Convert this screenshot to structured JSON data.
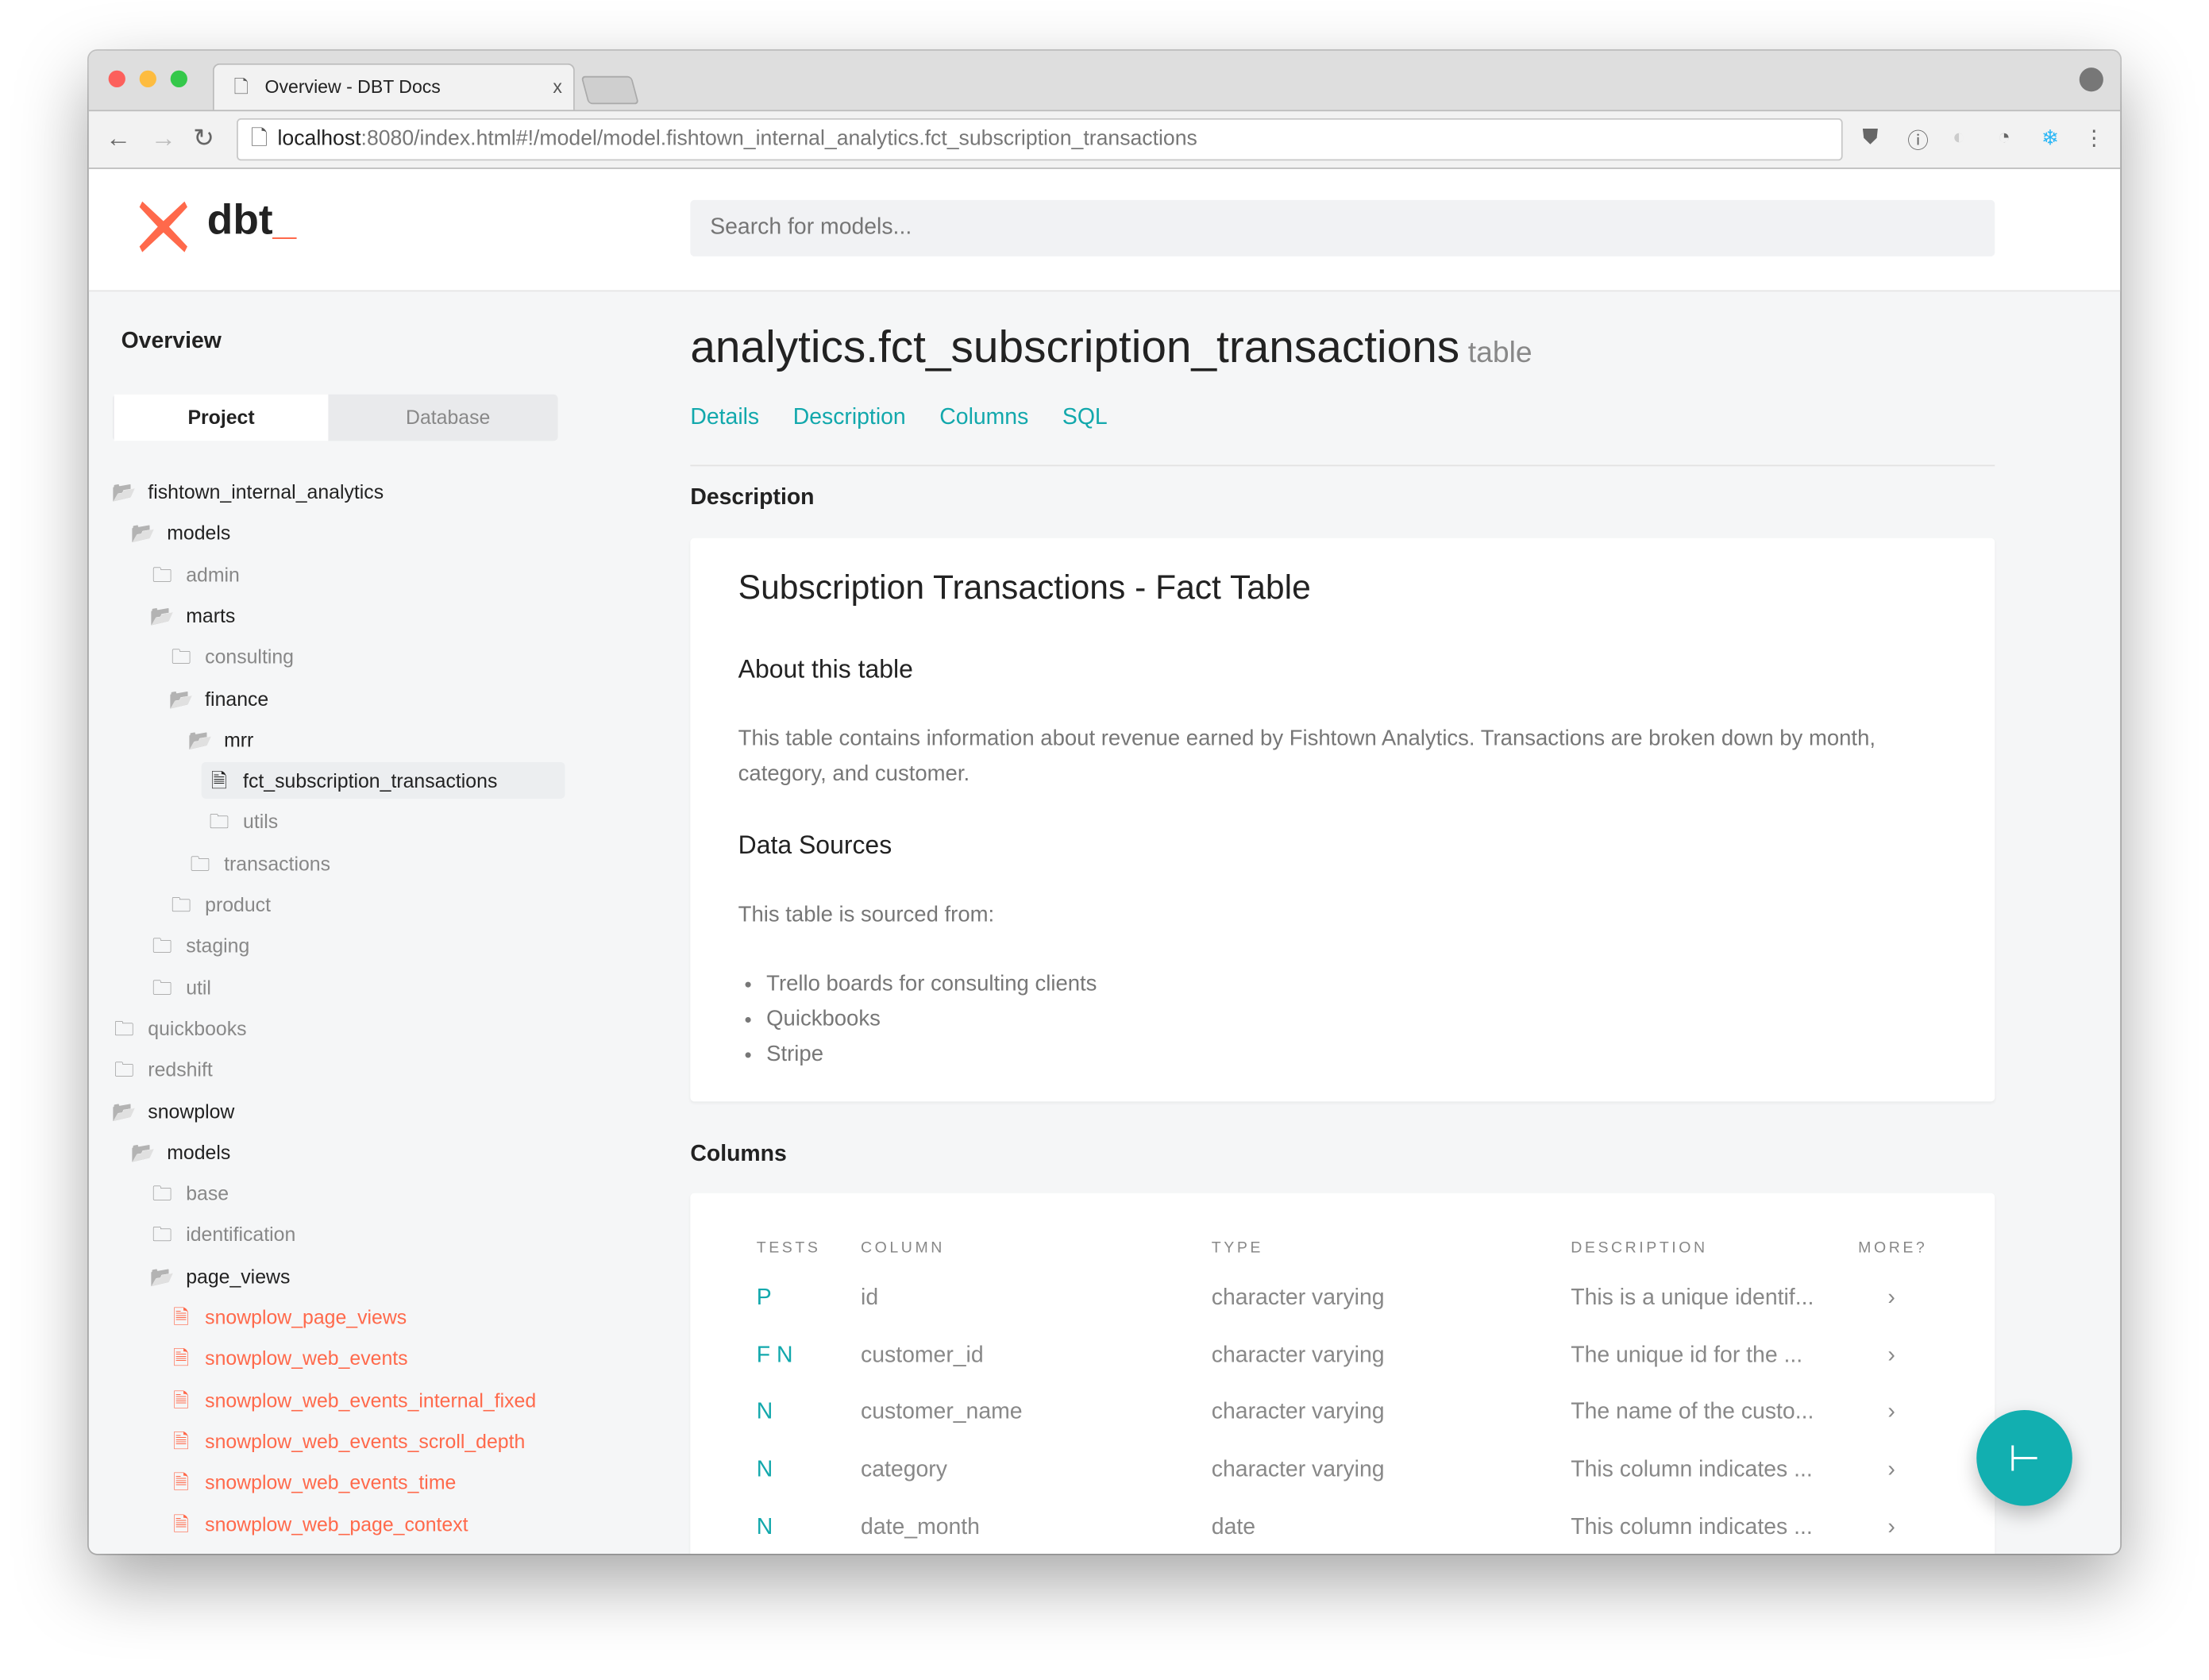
{
  "browser": {
    "tab_title": "Overview - DBT Docs",
    "tab_close": "x",
    "url_host": "localhost",
    "url_rest": ":8080/index.html#!/model/model.fishtown_internal_analytics.fct_subscription_transactions"
  },
  "header": {
    "logo_text": "dbt",
    "logo_underscore": "_",
    "search_placeholder": "Search for models..."
  },
  "sidebar": {
    "title": "Overview",
    "toggle": [
      "Project",
      "Database"
    ],
    "tree": [
      {
        "label": "fishtown_internal_analytics",
        "depth": 0,
        "kind": "folder-open"
      },
      {
        "label": "models",
        "depth": 1,
        "kind": "folder-open"
      },
      {
        "label": "admin",
        "depth": 2,
        "kind": "folder"
      },
      {
        "label": "marts",
        "depth": 2,
        "kind": "folder-open"
      },
      {
        "label": "consulting",
        "depth": 3,
        "kind": "folder"
      },
      {
        "label": "finance",
        "depth": 3,
        "kind": "folder-open"
      },
      {
        "label": "mrr",
        "depth": 4,
        "kind": "folder-open"
      },
      {
        "label": "fct_subscription_transactions",
        "depth": 5,
        "kind": "file-selected"
      },
      {
        "label": "utils",
        "depth": 5,
        "kind": "folder"
      },
      {
        "label": "transactions",
        "depth": 4,
        "kind": "folder"
      },
      {
        "label": "product",
        "depth": 3,
        "kind": "folder"
      },
      {
        "label": "staging",
        "depth": 2,
        "kind": "folder"
      },
      {
        "label": "util",
        "depth": 2,
        "kind": "folder"
      },
      {
        "label": "quickbooks",
        "depth": 0,
        "kind": "folder"
      },
      {
        "label": "redshift",
        "depth": 0,
        "kind": "folder"
      },
      {
        "label": "snowplow",
        "depth": 0,
        "kind": "folder-open"
      },
      {
        "label": "models",
        "depth": 1,
        "kind": "folder-open"
      },
      {
        "label": "base",
        "depth": 2,
        "kind": "folder"
      },
      {
        "label": "identification",
        "depth": 2,
        "kind": "folder"
      },
      {
        "label": "page_views",
        "depth": 2,
        "kind": "folder-open"
      },
      {
        "label": "snowplow_page_views",
        "depth": 3,
        "kind": "file-red"
      },
      {
        "label": "snowplow_web_events",
        "depth": 3,
        "kind": "file-red"
      },
      {
        "label": "snowplow_web_events_internal_fixed",
        "depth": 3,
        "kind": "file-red"
      },
      {
        "label": "snowplow_web_events_scroll_depth",
        "depth": 3,
        "kind": "file-red"
      },
      {
        "label": "snowplow_web_events_time",
        "depth": 3,
        "kind": "file-red"
      },
      {
        "label": "snowplow_web_page_context",
        "depth": 3,
        "kind": "file-red"
      }
    ]
  },
  "main": {
    "title": "analytics.fct_subscription_transactions",
    "title_type": "table",
    "tabs": [
      "Details",
      "Description",
      "Columns",
      "SQL"
    ],
    "description_heading": "Description",
    "doc": {
      "h1": "Subscription Transactions - Fact Table",
      "about_heading": "About this table",
      "about_text": "This table contains information about revenue earned by Fishtown Analytics. Transactions are broken down by month, category, and customer.",
      "sources_heading": "Data Sources",
      "sources_text": "This table is sourced from:",
      "sources": [
        "Trello boards for consulting clients",
        "Quickbooks",
        "Stripe"
      ]
    },
    "columns_heading": "Columns",
    "columns_table": {
      "headers": [
        "TESTS",
        "COLUMN",
        "TYPE",
        "DESCRIPTION",
        "MORE?"
      ],
      "rows": [
        {
          "tests": "P",
          "column": "id",
          "type": "character varying",
          "description": "This is a unique identif...",
          "more": "›"
        },
        {
          "tests": "F N",
          "column": "customer_id",
          "type": "character varying",
          "description": "The unique id for the ...",
          "more": "›"
        },
        {
          "tests": "N",
          "column": "customer_name",
          "type": "character varying",
          "description": "The name of the custo...",
          "more": "›"
        },
        {
          "tests": "N",
          "column": "category",
          "type": "character varying",
          "description": "This column indicates ...",
          "more": "›"
        },
        {
          "tests": "N",
          "column": "date_month",
          "type": "date",
          "description": "This column indicates ...",
          "more": "›"
        }
      ]
    }
  },
  "colors": {
    "accent": "#12a8ac",
    "brand": "#ff694b"
  }
}
